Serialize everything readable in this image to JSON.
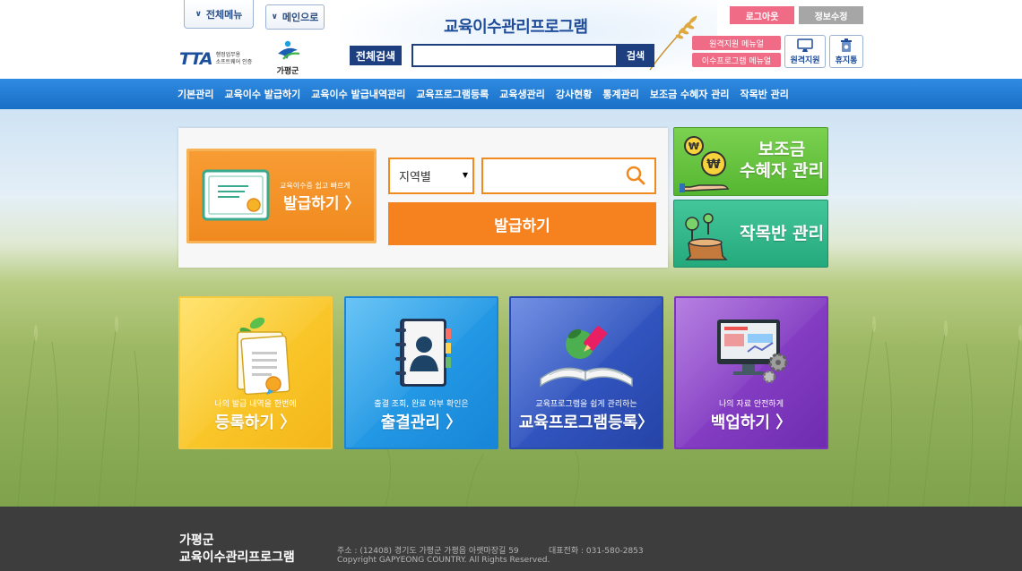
{
  "header": {
    "all_menu_label": "전체메뉴",
    "main_label": "메인으로",
    "app_title": "교육이수관리프로그램",
    "tta_mark": "TTA",
    "tta_text_line1": "행정업무용",
    "tta_text_line2": "소프트웨어 인증",
    "county_logo_text": "가평군",
    "search_label": "전체검색",
    "search_value": "",
    "search_button": "검색",
    "logout_label": "로그아웃",
    "edit_info_label": "정보수정",
    "remote_manual_label": "원격지원 메뉴얼",
    "program_manual_label": "이수프로그램 메뉴얼",
    "remote_support_label": "원격지원",
    "trash_label": "휴지통"
  },
  "nav": {
    "items": [
      "기본관리",
      "교육이수 발급하기",
      "교육이수 발급내역관리",
      "교육프로그램등록",
      "교육생관리",
      "강사현황",
      "통계관리",
      "보조금 수혜자 관리",
      "작목반 관리"
    ]
  },
  "issue": {
    "cert_sub": "교육이수증 쉽고 빠르게",
    "cert_main": "발급하기 〉",
    "region_value": "지역별",
    "keyword_value": "",
    "issue_button": "발급하기"
  },
  "side": {
    "subsidy_line1": "보조금",
    "subsidy_line2": "수혜자 관리",
    "timber_label": "작목반 관리"
  },
  "tiles": [
    {
      "sub": "나의 발급 내역을 한번에",
      "main": "등록하기 〉",
      "icon": "certificate-icon"
    },
    {
      "sub": "출결 조회, 완료 여부 확인은",
      "main": "출결관리 〉",
      "icon": "address-book-icon"
    },
    {
      "sub": "교육프로그램을 쉽게 관리하는",
      "main": "교육프로그램등록〉",
      "icon": "book-pencil-icon"
    },
    {
      "sub": "나의 자료 안전하게",
      "main": "백업하기 〉",
      "icon": "monitor-gear-icon"
    }
  ],
  "footer": {
    "org_line1": "가평군",
    "org_line2": "교육이수관리프로그램",
    "address": "주소 : (12408) 경기도 가평군 가평읍 아랫마장길 59",
    "phone": "대표전화 : 031-580-2853",
    "copyright": "Copyright GAPYEONG COUNTRY. All Rights Reserved."
  },
  "colors": {
    "nav_blue": "#2280d6",
    "orange": "#f5821f",
    "pink": "#ef6b86",
    "navy": "#1e3f7f",
    "footer_bg": "#3d3d3d"
  }
}
